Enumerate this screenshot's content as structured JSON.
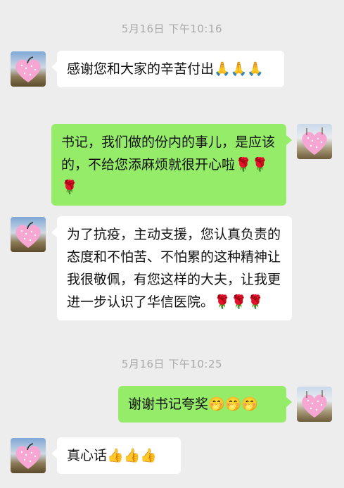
{
  "timestamps": [
    "5月16日 下午10:16",
    "5月16日 下午10:25"
  ],
  "messages": [
    {
      "side": "left",
      "text": "感谢您和大家的辛苦付出",
      "emoji": "🙏🙏🙏"
    },
    {
      "side": "right",
      "text": "书记，我们做的份内的事儿，是应该的，不给您添麻烦就很开心啦",
      "emoji": "🌹🌹🌹"
    },
    {
      "side": "left",
      "text": "为了抗疫，主动支援，您认真负责的态度和不怕苦、不怕累的这种精神让我很敬佩，有您这样的大夫，让我更进一步认识了华信医院。",
      "emoji": "🌹🌹🌹"
    },
    {
      "side": "right",
      "text": "谢谢书记夸奖",
      "emoji": "🤭🤭🤭"
    },
    {
      "side": "left",
      "text": "真心话",
      "emoji": "👍👍👍"
    }
  ],
  "colors": {
    "background": "#ededed",
    "bubble_left": "#ffffff",
    "bubble_right": "#95ec69",
    "timestamp": "#a9a9a9"
  },
  "avatars": {
    "left": "heart-avatar-icon",
    "right": "heart-avatar-icon"
  }
}
